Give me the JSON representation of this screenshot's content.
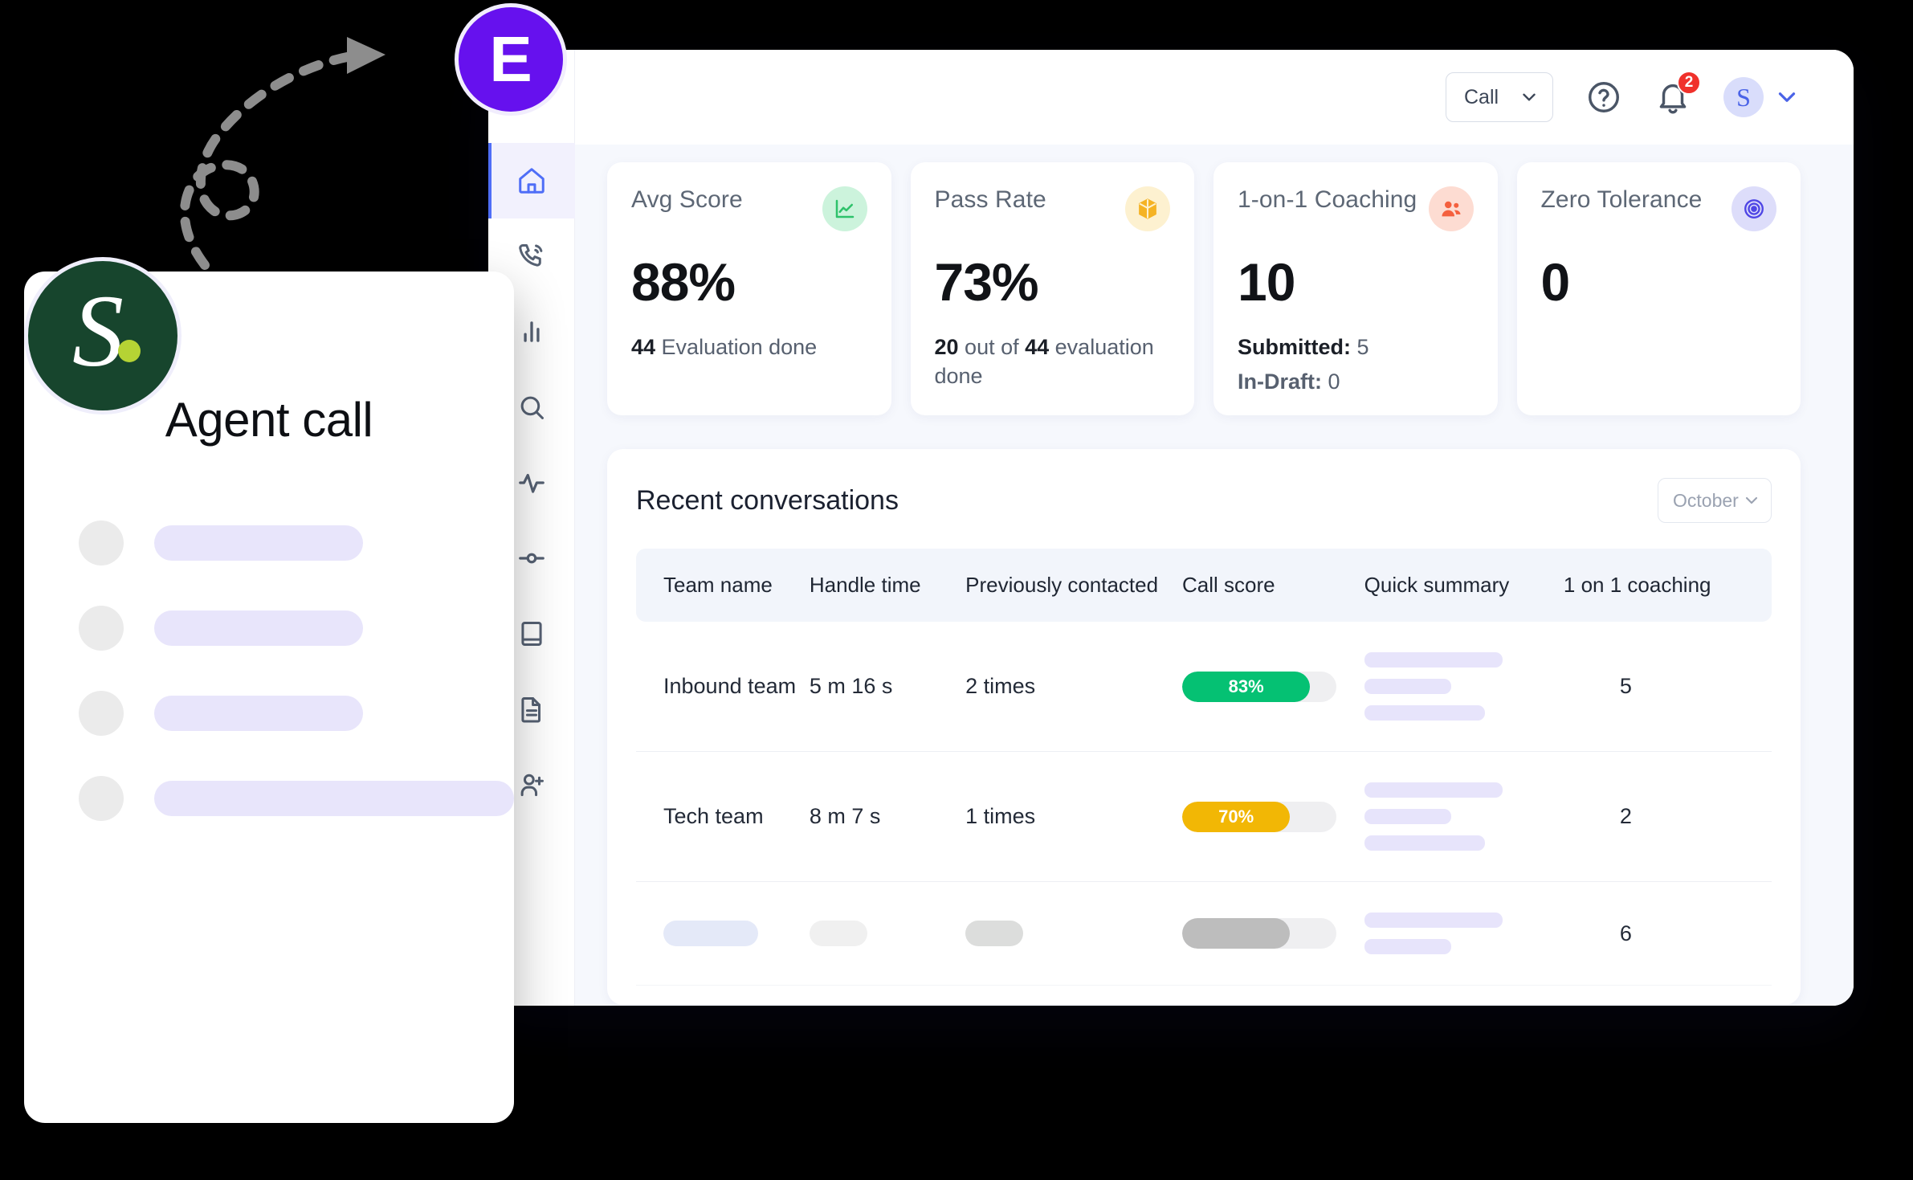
{
  "brand": {
    "left_logo_letter": "S",
    "left_logo_dot": "",
    "badge_letter": "E"
  },
  "left_panel": {
    "title": "Agent call",
    "skeleton_rows": 4
  },
  "topbar": {
    "call_filter_label": "Call",
    "help_icon": "question-circle-icon",
    "notification_icon": "bell-icon",
    "notification_count": "2",
    "avatar_initial": "S",
    "avatar_chevron": "chevron-down-icon"
  },
  "sidebar": {
    "items": [
      {
        "icon": "home-icon",
        "name": "home",
        "active": true
      },
      {
        "icon": "phone-call-icon",
        "name": "calls",
        "active": false
      },
      {
        "icon": "bar-chart-icon",
        "name": "analytics",
        "active": false
      },
      {
        "icon": "search-icon",
        "name": "search",
        "active": false
      },
      {
        "icon": "activity-pulse-icon",
        "name": "activity",
        "active": false
      },
      {
        "icon": "node-flow-icon",
        "name": "workflow",
        "active": false
      },
      {
        "icon": "book-icon",
        "name": "library",
        "active": false
      },
      {
        "icon": "document-icon",
        "name": "documents",
        "active": false
      },
      {
        "icon": "add-user-icon",
        "name": "add-user",
        "active": false
      }
    ]
  },
  "stat_cards": [
    {
      "title": "Avg Score",
      "value": "88%",
      "sub_strong": "44",
      "sub_rest": " Evaluation done",
      "icon": "line-chart-icon",
      "icon_class": "ico-green",
      "accent": "#2ec26b"
    },
    {
      "title": "Pass Rate",
      "value": "73%",
      "sub_strong": "20",
      "sub_mid": " out of ",
      "sub_strong2": "44",
      "sub_rest": " evaluation done",
      "icon": "cube-icon",
      "icon_class": "ico-yellow",
      "accent": "#f5b324"
    },
    {
      "title": "1-on-1 Coaching",
      "value": "10",
      "line1_label": "Submitted:",
      "line1_value": " 5",
      "line2_label": "In-Draft:",
      "line2_value": " 0",
      "icon": "people-icon",
      "icon_class": "ico-red",
      "accent": "#f4603e"
    },
    {
      "title": "Zero Tolerance",
      "value": "0",
      "icon": "target-icon",
      "icon_class": "ico-purple",
      "accent": "#4f46e5"
    }
  ],
  "conversations": {
    "title": "Recent conversations",
    "month_filter": "October",
    "month_chevron": "chevron-down-icon",
    "columns": [
      "Team name",
      "Handle time",
      "Previously contacted",
      "Call score",
      "Quick summary",
      "1 on 1 coaching"
    ],
    "rows": [
      {
        "team_name": "Inbound team",
        "handle_time": "5 m 16 s",
        "previously_contacted": "2 times",
        "call_score_label": "83%",
        "call_score_pct": 83,
        "call_score_color": "#05c173",
        "coaching": "5",
        "skeleton": false
      },
      {
        "team_name": "Tech team",
        "handle_time": "8 m 7 s",
        "previously_contacted": "1 times",
        "call_score_label": "70%",
        "call_score_pct": 70,
        "call_score_color": "#f2b705",
        "coaching": "2",
        "skeleton": false
      },
      {
        "team_name": "",
        "handle_time": "",
        "previously_contacted": "",
        "call_score_label": "",
        "call_score_pct": 70,
        "call_score_color": "#bdbdbd",
        "coaching": "6",
        "skeleton": true
      }
    ]
  },
  "colors": {
    "app_bg": "#f6f8fd",
    "brand_purple": "#6611ee",
    "brand_green": "#17452d",
    "accent_blue": "#4f6ef7",
    "skeleton_lavender": "#e8e5fb"
  }
}
